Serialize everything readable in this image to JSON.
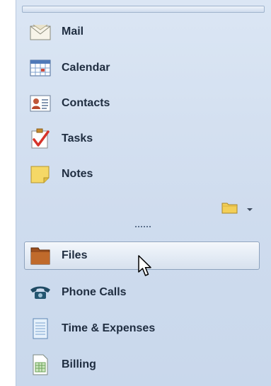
{
  "nav": {
    "items": [
      {
        "label": "Mail",
        "icon": "mail-icon"
      },
      {
        "label": "Calendar",
        "icon": "calendar-icon"
      },
      {
        "label": "Contacts",
        "icon": "contacts-icon"
      },
      {
        "label": "Tasks",
        "icon": "tasks-icon"
      },
      {
        "label": "Notes",
        "icon": "notes-icon"
      }
    ],
    "folder_menu_icon": "folder-icon",
    "custom_items": [
      {
        "label": "Files",
        "icon": "files-folder-icon",
        "selected": true
      },
      {
        "label": "Phone Calls",
        "icon": "phone-icon",
        "selected": false
      },
      {
        "label": "Time & Expenses",
        "icon": "time-expenses-icon",
        "selected": false
      },
      {
        "label": "Billing",
        "icon": "billing-icon",
        "selected": false
      }
    ]
  },
  "colors": {
    "pane_background": "#cfdcee",
    "label_text": "#1f2d40",
    "selection_border": "#8da2bd"
  }
}
